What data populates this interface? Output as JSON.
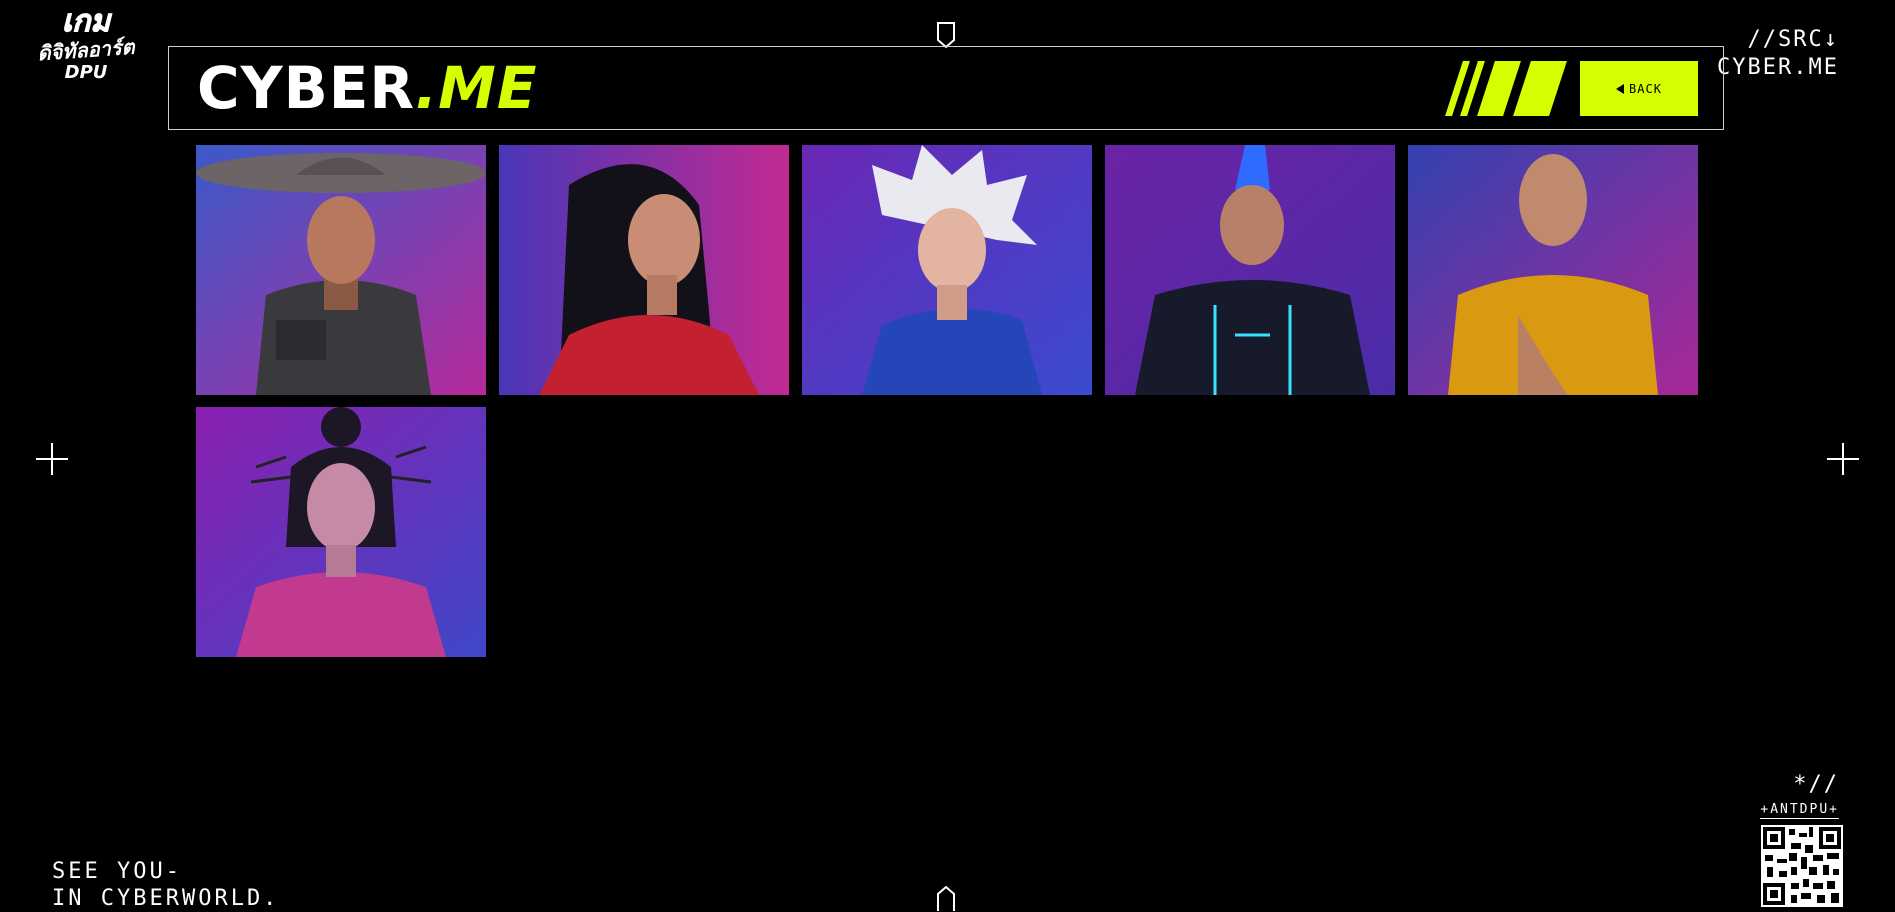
{
  "logo": {
    "line1": "เกม",
    "line2": "ดิจิทัลอาร์ต",
    "line3": "DPU"
  },
  "src_label": {
    "line1": "//SRC↓",
    "line2": "CYBER.ME"
  },
  "header": {
    "brand_white": "CYBER",
    "brand_green": ".ME",
    "back_label": "BACK"
  },
  "avatars": [
    {
      "name": "Avatar with conical hat",
      "bg": [
        "#3b59c9",
        "#b52a9b"
      ]
    },
    {
      "name": "Avatar with braided hair",
      "bg": [
        "#4936b8",
        "#c22a92"
      ]
    },
    {
      "name": "Avatar with white spiky hair",
      "bg": [
        "#6a27b5",
        "#3a4bd0"
      ]
    },
    {
      "name": "Avatar with blue mohawk",
      "bg": [
        "#6b23a6",
        "#4a2ca8"
      ]
    },
    {
      "name": "Avatar in orange robe",
      "bg": [
        "#3341b0",
        "#a92897"
      ]
    },
    {
      "name": "Avatar with hairpins",
      "bg": [
        "#8a1fb0",
        "#3f47c8"
      ]
    }
  ],
  "footer": {
    "line1": "SEE YOU-",
    "line2": "IN CYBERWORLD."
  },
  "corner": {
    "line1": "*//",
    "line2": "+ANTDPU+"
  },
  "colors": {
    "accent": "#d4ff00",
    "background": "#000000"
  }
}
